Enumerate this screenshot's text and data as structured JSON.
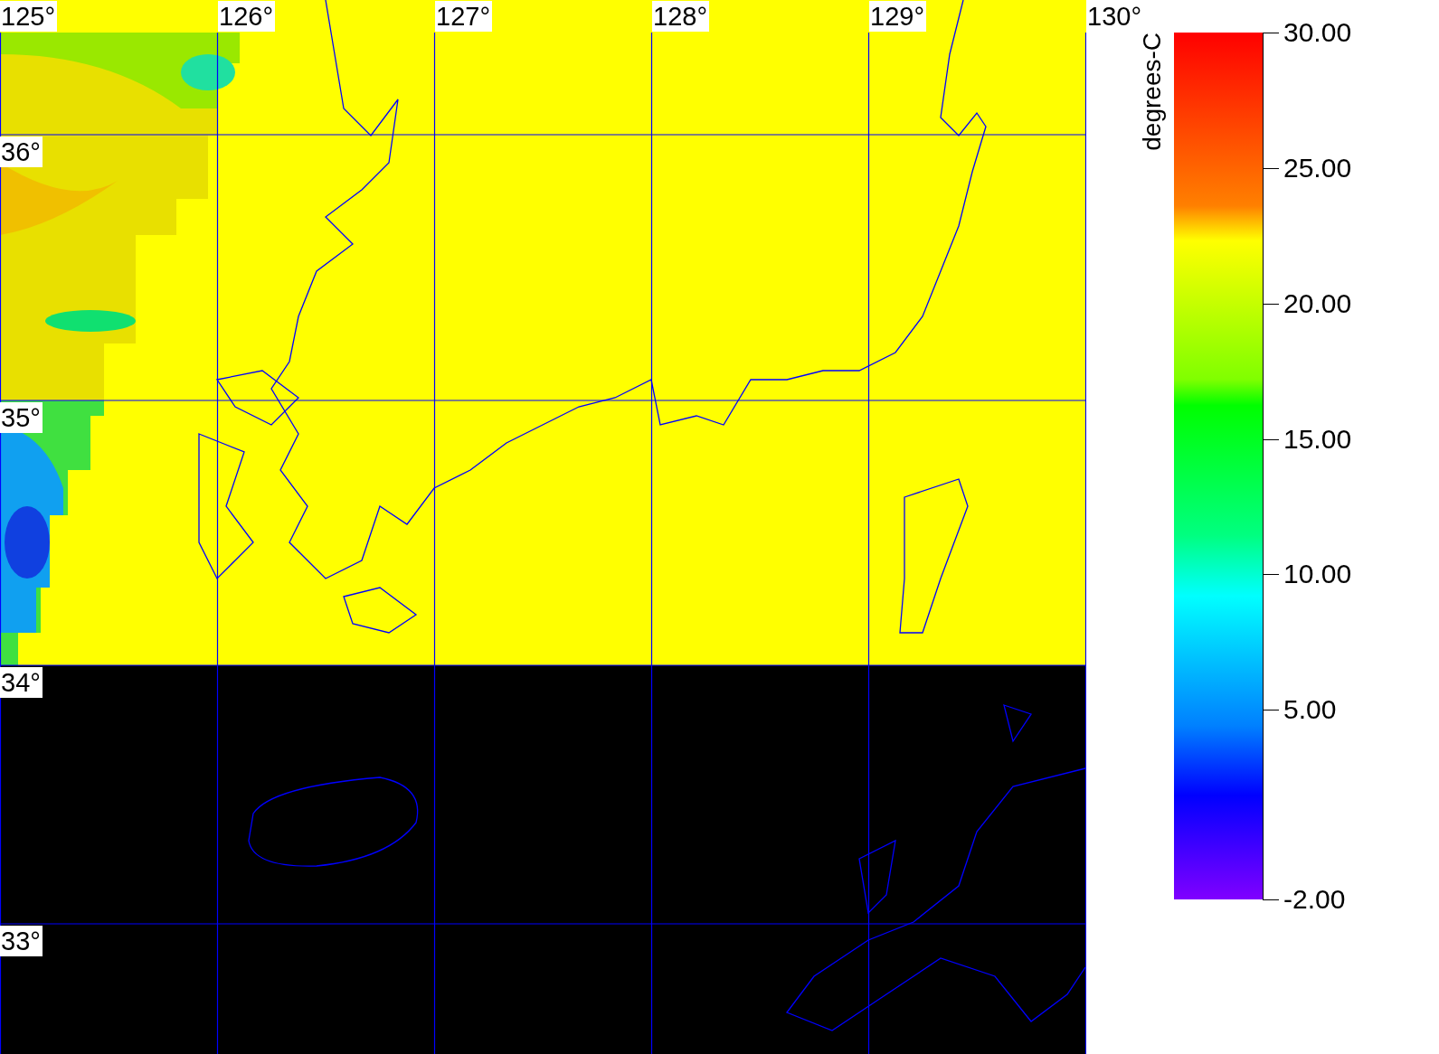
{
  "map": {
    "longitude_labels": [
      "125°",
      "126°",
      "127°",
      "128°",
      "129°",
      "130°"
    ],
    "latitude_labels": [
      "36°",
      "35°",
      "34°",
      "33°"
    ]
  },
  "colorbar": {
    "title": "degrees-C",
    "ticks": [
      "30.00",
      "25.00",
      "20.00",
      "15.00",
      "10.00",
      "5.00",
      "-2.00"
    ]
  }
}
